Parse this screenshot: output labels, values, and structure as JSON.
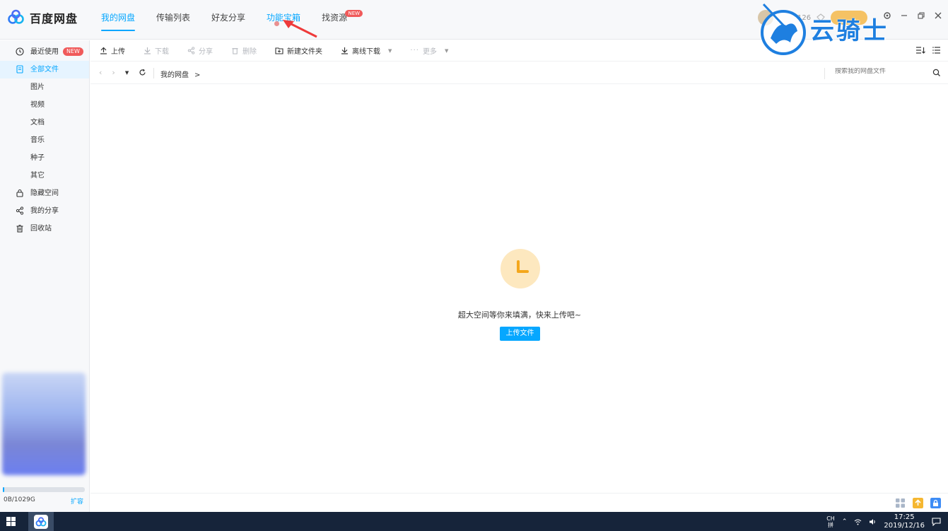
{
  "app": {
    "name": "百度网盘",
    "brand_color": "#06a7ff"
  },
  "nav": {
    "tabs": [
      {
        "label": "我的网盘",
        "state": "active"
      },
      {
        "label": "传输列表",
        "state": "normal"
      },
      {
        "label": "好友分享",
        "state": "normal"
      },
      {
        "label": "功能宝箱",
        "state": "hover"
      },
      {
        "label": "找资源",
        "state": "normal",
        "badge": "NEW"
      }
    ]
  },
  "header_right": {
    "count_text": "126"
  },
  "watermark": {
    "text": "云骑士"
  },
  "sidebar": {
    "items": [
      {
        "label": "最近使用",
        "icon": "clock-icon",
        "badge": "NEW"
      },
      {
        "label": "全部文件",
        "icon": "file-icon",
        "active": true
      },
      {
        "label": "图片"
      },
      {
        "label": "视频"
      },
      {
        "label": "文档"
      },
      {
        "label": "音乐"
      },
      {
        "label": "种子"
      },
      {
        "label": "其它"
      },
      {
        "label": "隐藏空间",
        "icon": "lock-icon"
      },
      {
        "label": "我的分享",
        "icon": "share-icon"
      },
      {
        "label": "回收站",
        "icon": "trash-icon"
      }
    ],
    "quota": {
      "text": "0B/1029G",
      "used_fraction": 0.0,
      "expand_label": "扩容"
    }
  },
  "toolbar": {
    "upload": "上传",
    "download": "下载",
    "share": "分享",
    "delete": "删除",
    "new_folder": "新建文件夹",
    "offline_download": "离线下载",
    "more": "更多"
  },
  "pathbar": {
    "crumb": "我的网盘",
    "crumb_sep": ">",
    "search_placeholder": "搜索我的网盘文件"
  },
  "empty_state": {
    "message": "超大空间等你来填满，快来上传吧~",
    "button": "上传文件"
  },
  "taskbar": {
    "ime_line1": "CH",
    "ime_line2": "拼",
    "time": "17:25",
    "date": "2019/12/16"
  }
}
